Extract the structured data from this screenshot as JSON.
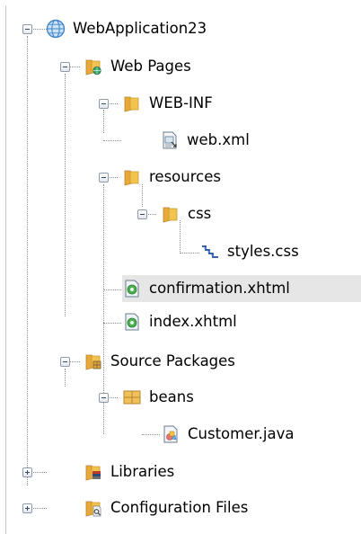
{
  "tree": {
    "project": {
      "label": "WebApplication23",
      "icon": "globe-project-icon"
    },
    "web_pages": {
      "label": "Web Pages",
      "icon": "web-pages-folder-icon"
    },
    "web_inf": {
      "label": "WEB-INF",
      "icon": "folder-icon"
    },
    "web_xml": {
      "label": "web.xml",
      "icon": "xml-file-icon"
    },
    "resources": {
      "label": "resources",
      "icon": "folder-icon"
    },
    "css": {
      "label": "css",
      "icon": "folder-icon"
    },
    "styles_css": {
      "label": "styles.css",
      "icon": "css-file-icon"
    },
    "confirmation_xhtml": {
      "label": "confirmation.xhtml",
      "icon": "xhtml-file-icon",
      "selected": true
    },
    "index_xhtml": {
      "label": "index.xhtml",
      "icon": "xhtml-file-icon"
    },
    "source_packages": {
      "label": "Source Packages",
      "icon": "source-packages-icon"
    },
    "beans": {
      "label": "beans",
      "icon": "package-icon"
    },
    "customer_java": {
      "label": "Customer.java",
      "icon": "java-class-icon"
    },
    "libraries": {
      "label": "Libraries",
      "icon": "libraries-icon",
      "collapsed": true
    },
    "configuration_files": {
      "label": "Configuration Files",
      "icon": "configuration-files-icon",
      "collapsed": true
    }
  },
  "colors": {
    "folder": "#f2c34d",
    "selection": "#e6e6e6",
    "connector": "#8a8a8a",
    "globe": "#3f86c9"
  }
}
